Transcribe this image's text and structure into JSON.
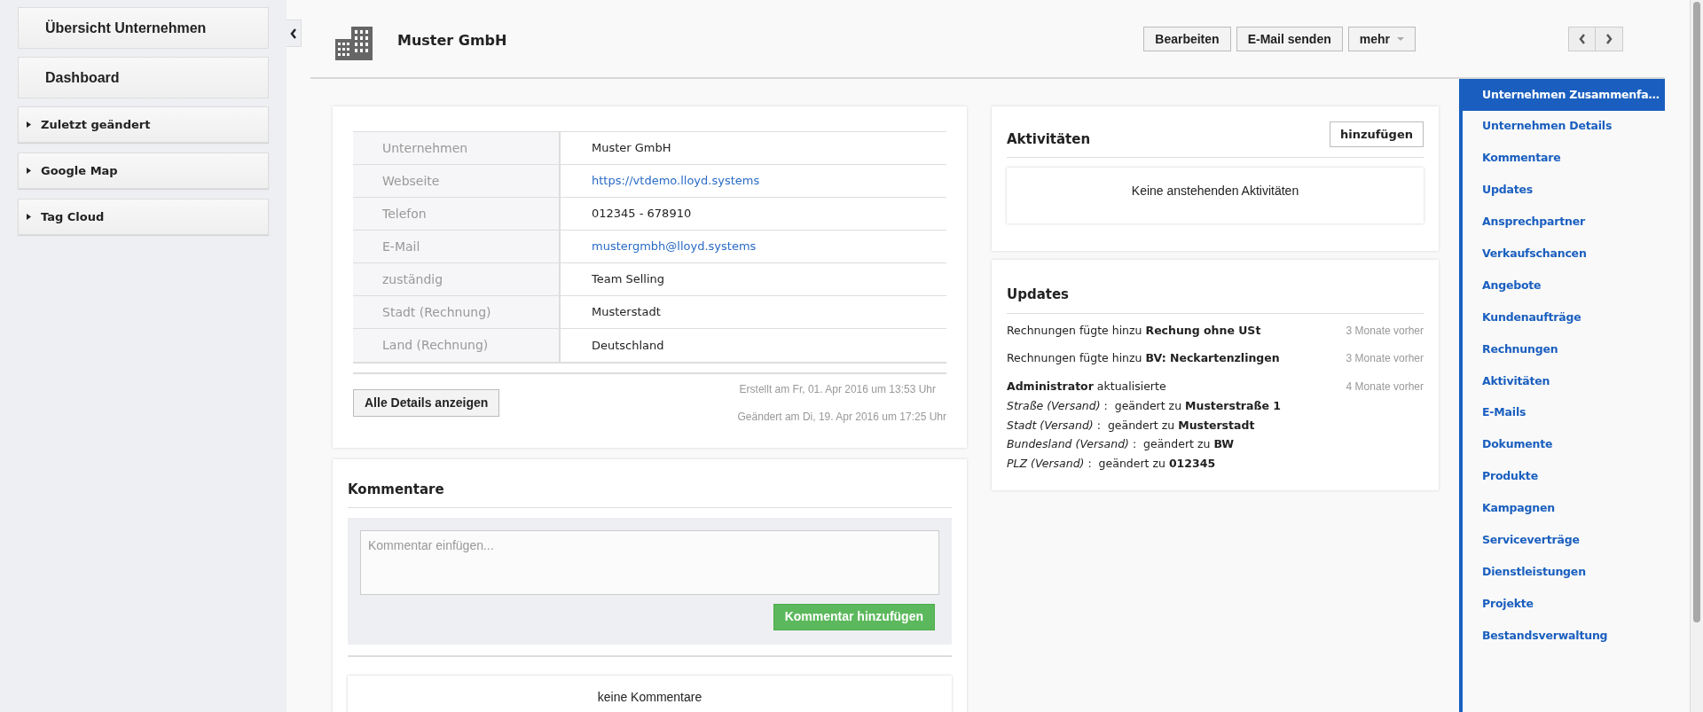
{
  "sidebar": {
    "items": [
      {
        "label": "Übersicht Unternehmen",
        "kind": "link"
      },
      {
        "label": "Dashboard",
        "kind": "link"
      },
      {
        "label": "Zuletzt geändert",
        "kind": "collapsible"
      },
      {
        "label": "Google Map",
        "kind": "collapsible"
      },
      {
        "label": "Tag Cloud",
        "kind": "collapsible"
      }
    ]
  },
  "header": {
    "title": "Muster GmbH",
    "buttons": [
      {
        "label": "Bearbeiten",
        "kind": "button"
      },
      {
        "label": "E-Mail senden",
        "kind": "button"
      },
      {
        "label": "mehr",
        "kind": "dropdown"
      }
    ]
  },
  "summary": {
    "fields": [
      {
        "label": "Unternehmen",
        "value": "Muster GmbH",
        "kind": "text"
      },
      {
        "label": "Webseite",
        "value": "https://vtdemo.lloyd.systems",
        "kind": "link"
      },
      {
        "label": "Telefon",
        "value": "012345 - 678910",
        "kind": "text"
      },
      {
        "label": "E-Mail",
        "value": "mustergmbh@lloyd.systems",
        "kind": "link"
      },
      {
        "label": "zuständig",
        "value": "Team Selling",
        "kind": "text"
      },
      {
        "label": "Stadt (Rechnung)",
        "value": "Musterstadt",
        "kind": "text"
      },
      {
        "label": "Land (Rechnung)",
        "value": "Deutschland",
        "kind": "text"
      }
    ],
    "details_button": "Alle Details anzeigen",
    "created": "Erstellt am Fr, 01. Apr 2016 um 13:53 Uhr",
    "modified": "Geändert am Di, 19. Apr 2016 um 17:25 Uhr"
  },
  "comments": {
    "title": "Kommentare",
    "placeholder": "Kommentar einfügen...",
    "submit": "Kommentar hinzufügen",
    "empty": "keine Kommentare"
  },
  "activities": {
    "title": "Aktivitäten",
    "add_button": "hinzufügen",
    "empty": "Keine anstehenden Aktivitäten"
  },
  "updates": {
    "title": "Updates",
    "items": [
      {
        "text": "Rechnungen fügte hinzu **Rechung ohne USt**",
        "time": "3 Monate vorher"
      },
      {
        "text": "Rechnungen fügte hinzu **BV: Neckartenzlingen**",
        "time": "3 Monate vorher"
      },
      {
        "text": "**Administrator** aktualisierte",
        "time": "4 Monate vorher",
        "changes": [
          "*Straße (Versand)* :  geändert zu **Musterstraße 1**",
          "*Stadt (Versand)* :  geändert zu **Musterstadt**",
          "*Bundesland (Versand)* :  geändert zu **BW**",
          "*PLZ (Versand)* :  geändert zu **012345**"
        ]
      }
    ]
  },
  "related": {
    "items": [
      {
        "label": "Unternehmen Zusammenfa…",
        "selected": true
      },
      {
        "label": "Unternehmen Details",
        "selected": false
      },
      {
        "label": "Kommentare",
        "selected": false
      },
      {
        "label": "Updates",
        "selected": false
      },
      {
        "label": "Ansprechpartner",
        "selected": false
      },
      {
        "label": "Verkaufschancen",
        "selected": false
      },
      {
        "label": "Angebote",
        "selected": false
      },
      {
        "label": "Kundenaufträge",
        "selected": false
      },
      {
        "label": "Rechnungen",
        "selected": false
      },
      {
        "label": "Aktivitäten",
        "selected": false
      },
      {
        "label": "E-Mails",
        "selected": false
      },
      {
        "label": "Dokumente",
        "selected": false
      },
      {
        "label": "Produkte",
        "selected": false
      },
      {
        "label": "Kampagnen",
        "selected": false
      },
      {
        "label": "Serviceverträge",
        "selected": false
      },
      {
        "label": "Dienstleistungen",
        "selected": false
      },
      {
        "label": "Projekte",
        "selected": false
      },
      {
        "label": "Bestandsverwaltung",
        "selected": false
      }
    ]
  }
}
